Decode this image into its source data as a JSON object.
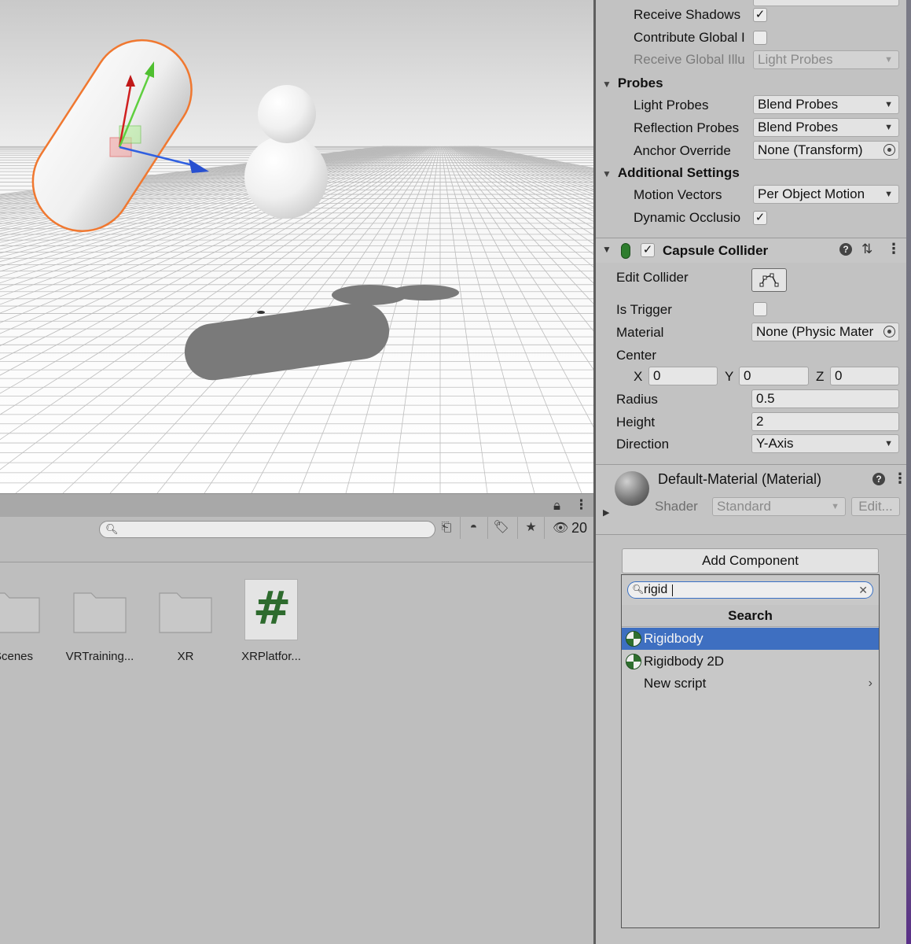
{
  "inspector": {
    "lighting_rows": [
      {
        "label": "Receive Shadows",
        "checked": "✓"
      },
      {
        "label": "Contribute Global I",
        "checked": ""
      }
    ],
    "receive_gi": {
      "label": "Receive Global Illu",
      "value": "Light Probes"
    },
    "probes": {
      "title": "Probes",
      "light_probes": {
        "label": "Light Probes",
        "value": "Blend Probes"
      },
      "reflection_probes": {
        "label": "Reflection Probes",
        "value": "Blend Probes"
      },
      "anchor_override": {
        "label": "Anchor Override",
        "value": "None (Transform)"
      }
    },
    "additional": {
      "title": "Additional Settings",
      "motion_vectors": {
        "label": "Motion Vectors",
        "value": "Per Object Motion"
      },
      "dynamic_occlusion": {
        "label": "Dynamic Occlusio",
        "checked": "✓"
      }
    },
    "capsule_collider": {
      "title": "Capsule Collider",
      "enabled_check": "✓",
      "edit_collider": "Edit Collider",
      "is_trigger": "Is Trigger",
      "material": {
        "label": "Material",
        "value": "None (Physic Mater"
      },
      "center": {
        "label": "Center",
        "x_label": "X",
        "x": "0",
        "y_label": "Y",
        "y": "0",
        "z_label": "Z",
        "z": "0"
      },
      "radius": {
        "label": "Radius",
        "value": "0.5"
      },
      "height": {
        "label": "Height",
        "value": "2"
      },
      "direction": {
        "label": "Direction",
        "value": "Y-Axis"
      }
    },
    "material": {
      "name": "Default-Material (Material)",
      "shader_label": "Shader",
      "shader_value": "Standard",
      "edit_button": "Edit..."
    },
    "add_component": "Add Component",
    "popup": {
      "search_value": "rigid",
      "clear_icon": "✕",
      "title": "Search",
      "items": [
        {
          "label": "Rigidbody",
          "selected": true
        },
        {
          "label": "Rigidbody 2D",
          "selected": false
        },
        {
          "label": "New script",
          "submenu": "›"
        }
      ]
    }
  },
  "project": {
    "hidden_count": "20",
    "assets": [
      {
        "label": "Scenes",
        "type": "folder"
      },
      {
        "label": "VRTraining...",
        "type": "folder"
      },
      {
        "label": "XR",
        "type": "folder"
      },
      {
        "label": "XRPlatfor...",
        "type": "script",
        "glyph": "#"
      }
    ]
  },
  "colors": {
    "selection_blue": "#3e6fc1",
    "outline_orange": "#f07830",
    "gizmo_x": "#d02020",
    "gizmo_y": "#5fcf3f",
    "gizmo_z": "#3060e0"
  }
}
